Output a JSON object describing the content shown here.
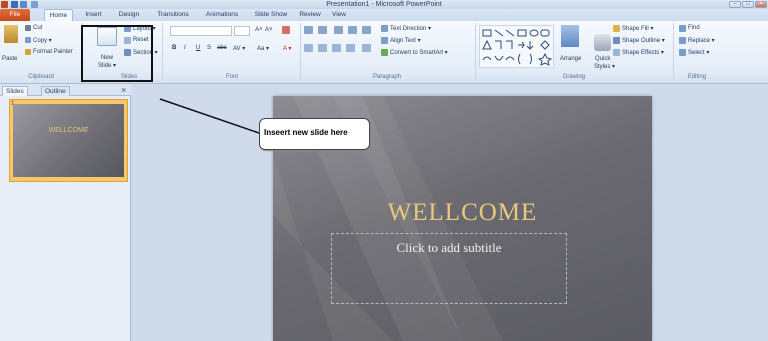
{
  "app": {
    "title": "Presentation1 - Microsoft PowerPoint"
  },
  "tabs": [
    "File",
    "Home",
    "Insert",
    "Design",
    "Transitions",
    "Animations",
    "Slide Show",
    "Review",
    "View"
  ],
  "clipboard": {
    "paste": "Paste",
    "cut": "Cut",
    "copy": "Copy ▾",
    "format_painter": "Format Painter",
    "group": "Clipboard"
  },
  "slides_group": {
    "new_slide": "New",
    "new_slide2": "Slide ▾",
    "layout": "Layout ▾",
    "reset": "Reset",
    "section": "Section ▾",
    "group": "Slides"
  },
  "font": {
    "grow": "A˄",
    "shrink": "A˅",
    "bold": "B",
    "italic": "I",
    "underline": "U",
    "strike": "S",
    "abc": "abc",
    "spacing": "AV ▾",
    "case": "Aa ▾",
    "color": "A ▾",
    "group": "Font"
  },
  "paragraph": {
    "text_direction": "Text Direction ▾",
    "align_text": "Align Text ▾",
    "smartart": "Convert to SmartArt ▾",
    "group": "Paragraph"
  },
  "drawing": {
    "arrange": "Arrange",
    "quick_styles": "Quick",
    "quick_styles2": "Styles ▾",
    "shape_fill": "Shape Fill ▾",
    "shape_outline": "Shape Outline ▾",
    "shape_effects": "Shape Effects ▾",
    "group": "Drawing"
  },
  "editing": {
    "find": "Find",
    "replace": "Replace ▾",
    "select": "Select ▾",
    "group": "Editing"
  },
  "panel": {
    "slides_tab": "Slides",
    "outline_tab": "Outline",
    "close": "×",
    "slide_number": "1",
    "thumb_title": "WELLCOME"
  },
  "slide": {
    "title": "WELLCOME",
    "subtitle": "Click to add subtitle"
  },
  "annotation": {
    "callout": "Inseert new slide here"
  }
}
